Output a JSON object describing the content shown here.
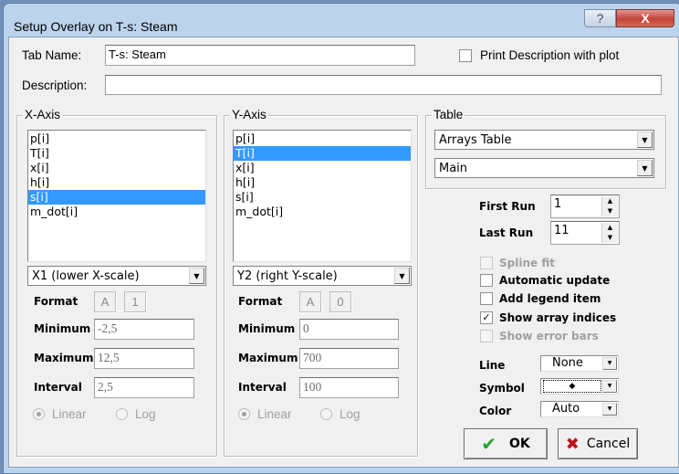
{
  "window": {
    "title": "Setup Overlay on T-s: Steam",
    "help_icon": "question-icon",
    "close_icon": "close-icon"
  },
  "header": {
    "tab_name_label": "Tab Name:",
    "tab_name_value": "T-s: Steam",
    "print_description_label": "Print Description with plot",
    "print_description_checked": false,
    "description_label": "Description:",
    "description_value": ""
  },
  "x_axis": {
    "title": "X-Axis",
    "items": [
      "p[i]",
      "T[i]",
      "x[i]",
      "h[i]",
      "s[i]",
      "m_dot[i]"
    ],
    "selected": "s[i]",
    "scale": "X1 (lower X-scale)",
    "format_label": "Format",
    "format_type": "A",
    "format_digits": "1",
    "minimum_label": "Minimum",
    "minimum": "-2,5",
    "maximum_label": "Maximum",
    "maximum": "12,5",
    "interval_label": "Interval",
    "interval": "2,5",
    "linear_label": "Linear",
    "log_label": "Log",
    "scale_type": "Linear"
  },
  "y_axis": {
    "title": "Y-Axis",
    "items": [
      "p[i]",
      "T[i]",
      "x[i]",
      "h[i]",
      "s[i]",
      "m_dot[i]"
    ],
    "selected": "T[i]",
    "scale": "Y2 (right Y-scale)",
    "format_label": "Format",
    "format_type": "A",
    "format_digits": "0",
    "minimum_label": "Minimum",
    "minimum": "0",
    "maximum_label": "Maximum",
    "maximum": "700",
    "interval_label": "Interval",
    "interval": "100",
    "linear_label": "Linear",
    "log_label": "Log",
    "scale_type": "Linear"
  },
  "table": {
    "title": "Table",
    "table_select": "Arrays Table",
    "sub_select": "Main"
  },
  "runs": {
    "first_label": "First Run",
    "first": "1",
    "last_label": "Last Run",
    "last": "11"
  },
  "options": [
    {
      "label": "Spline fit",
      "checked": false,
      "enabled": false
    },
    {
      "label": "Automatic update",
      "checked": false,
      "enabled": true
    },
    {
      "label": "Add legend item",
      "checked": false,
      "enabled": true
    },
    {
      "label": "Show array indices",
      "checked": true,
      "enabled": true
    },
    {
      "label": "Show error bars",
      "checked": false,
      "enabled": false
    }
  ],
  "style": {
    "line_label": "Line",
    "line": "None",
    "symbol_label": "Symbol",
    "symbol": "◆",
    "color_label": "Color",
    "color": "Auto"
  },
  "buttons": {
    "ok": "OK",
    "cancel": "Cancel"
  },
  "colors": {
    "selection": "#3399ff",
    "ok_check": "#2e9e2e",
    "cancel_x": "#c0141c",
    "close_button": "#c9463d"
  }
}
